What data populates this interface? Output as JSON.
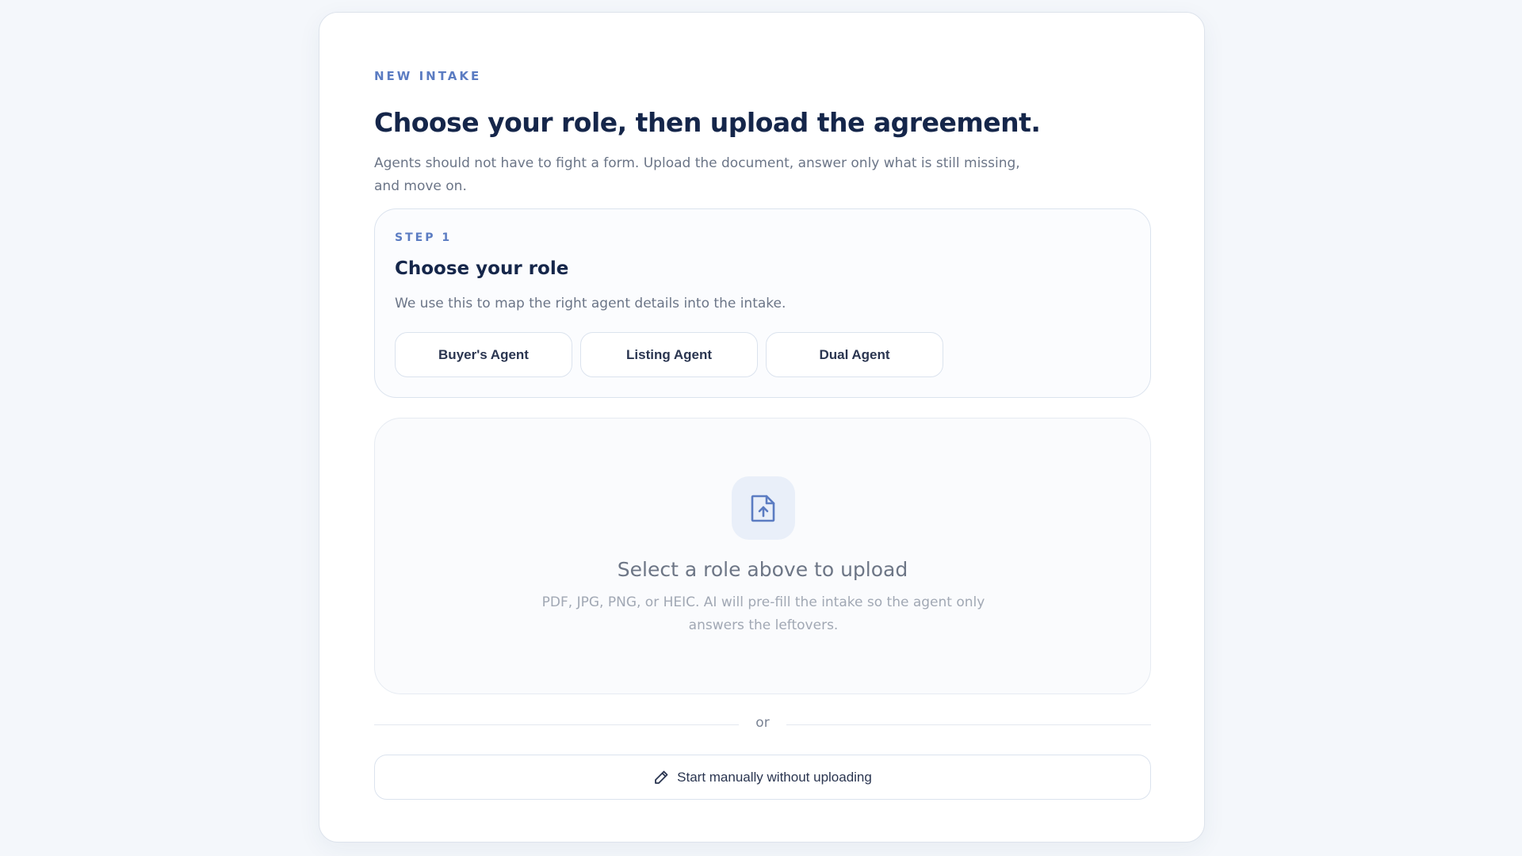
{
  "header": {
    "eyebrow": "NEW INTAKE",
    "title": "Choose your role, then upload the agreement.",
    "subtitle": "Agents should not have to fight a form. Upload the document, answer only what is still missing, and move on."
  },
  "step1": {
    "label": "STEP 1",
    "title": "Choose your role",
    "description": "We use this to map the right agent details into the intake.",
    "roles": [
      {
        "label": "Buyer's Agent"
      },
      {
        "label": "Listing Agent"
      },
      {
        "label": "Dual Agent"
      }
    ]
  },
  "upload": {
    "icon": "file-upload-icon",
    "title": "Select a role above to upload",
    "description": "PDF, JPG, PNG, or HEIC. AI will pre-fill the intake so the agent only answers the leftovers."
  },
  "divider": {
    "text": "or"
  },
  "manual": {
    "icon": "pencil-icon",
    "label": "Start manually without uploading"
  },
  "colors": {
    "accent": "#5b7cc2",
    "heading": "#15264a",
    "background": "#f4f7fb"
  }
}
